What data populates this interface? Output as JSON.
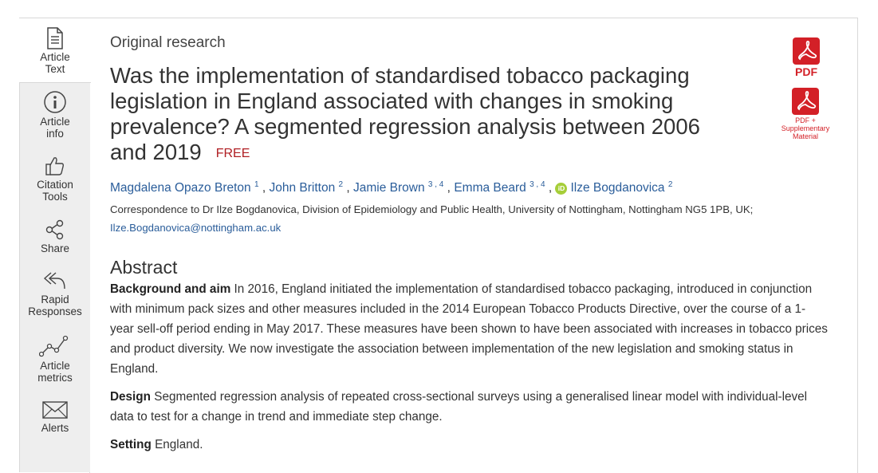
{
  "sidebar": {
    "items": [
      {
        "label_1": "Article",
        "label_2": "Text",
        "icon": "document-icon"
      },
      {
        "label_1": "Article",
        "label_2": "info",
        "icon": "info-icon"
      },
      {
        "label_1": "Citation",
        "label_2": "Tools",
        "icon": "thumbs-up-icon"
      },
      {
        "label_1": "Share",
        "label_2": "",
        "icon": "share-icon"
      },
      {
        "label_1": "Rapid",
        "label_2": "Responses",
        "icon": "reply-all-icon"
      },
      {
        "label_1": "Article",
        "label_2": "metrics",
        "icon": "line-chart-icon"
      },
      {
        "label_1": "Alerts",
        "label_2": "",
        "icon": "envelope-icon"
      }
    ]
  },
  "article": {
    "kicker": "Original research",
    "title": "Was the implementation of standardised tobacco packaging legislation in England associated with changes in smoking prevalence? A segmented regression analysis between 2006 and 2019",
    "free_badge": "FREE",
    "authors": [
      {
        "name": "Magdalena Opazo Breton",
        "aff": "1"
      },
      {
        "name": "John Britton",
        "aff": "2"
      },
      {
        "name": "Jamie Brown",
        "aff": "3 , 4"
      },
      {
        "name": "Emma Beard",
        "aff": "3 , 4"
      },
      {
        "name": "Ilze Bogdanovica",
        "aff": "2",
        "orcid": "iD"
      }
    ],
    "correspondence": "Correspondence to Dr Ilze Bogdanovica, Division of Epidemiology and Public Health, University of Nottingham, Nottingham NG5 1PB, UK;",
    "email": "Ilze.Bogdanovica@nottingham.ac.uk"
  },
  "downloads": {
    "pdf_label": "PDF",
    "supp_label_1": "PDF +",
    "supp_label_2": "Supplementary",
    "supp_label_3": "Material"
  },
  "abstract": {
    "heading": "Abstract",
    "sections": [
      {
        "label": "Background and aim",
        "text": " In 2016, England initiated the implementation of standardised tobacco packaging, introduced in conjunction with minimum pack sizes and other measures included in the 2014 European Tobacco Products Directive, over the course of a 1-year sell-off period ending in May 2017. These measures have been shown to have been associated with increases in tobacco prices and product diversity. We now investigate the association between implementation of the new legislation and smoking status in England."
      },
      {
        "label": "Design",
        "text": " Segmented regression analysis of repeated cross-sectional surveys using a generalised linear model with individual-level data to test for a change in trend and immediate step change."
      },
      {
        "label": "Setting",
        "text": " England."
      }
    ]
  },
  "colors": {
    "accent_red": "#d32027",
    "link_blue": "#2a5d9a",
    "orcid_green": "#a6ce39"
  }
}
